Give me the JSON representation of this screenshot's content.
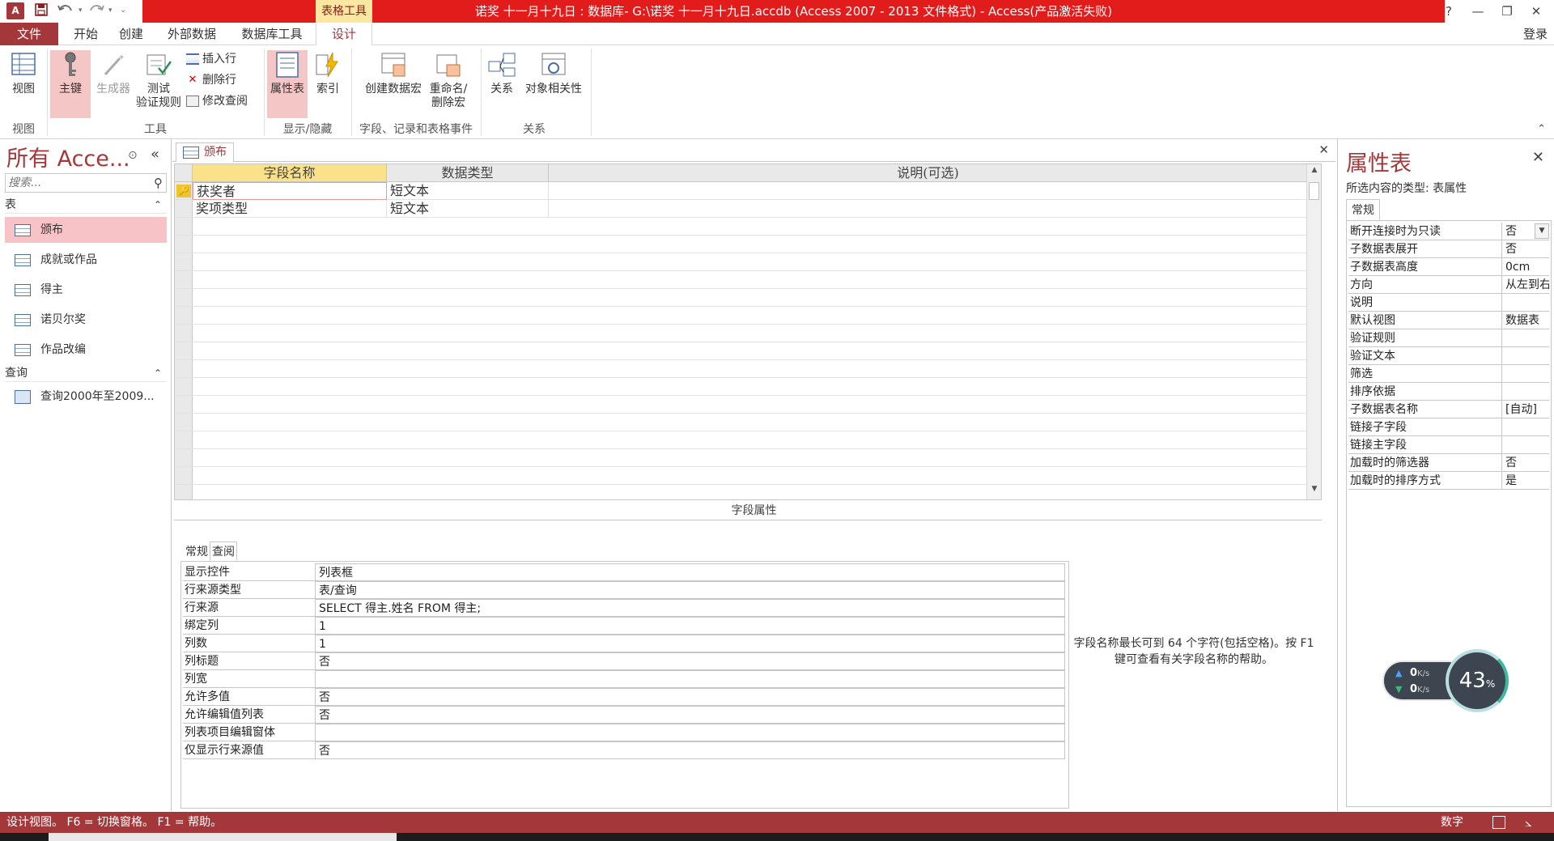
{
  "window": {
    "title": "诺奖 十一月十九日 : 数据库- G:\\诺奖 十一月十九日.accdb (Access 2007 - 2013 文件格式) - Access(产品激活失败)",
    "app_logo": "A",
    "context_tab": "表格工具",
    "controls": {
      "help": "?",
      "minimize": "—",
      "restore": "❐",
      "close": "✕"
    }
  },
  "tabs": [
    {
      "label": "文件"
    },
    {
      "label": "开始"
    },
    {
      "label": "创建"
    },
    {
      "label": "外部数据"
    },
    {
      "label": "数据库工具"
    },
    {
      "label": "设计"
    }
  ],
  "login": "登录",
  "ribbon": {
    "view": "视图",
    "primary_key": "主键",
    "builder": "生成器",
    "test_validation": "测试\n验证规则",
    "insert_row": "插入行",
    "delete_row": "删除行",
    "modify_lookups": "修改查阅",
    "property_sheet": "属性表",
    "indexes": "索引",
    "create_data_macros": "创建数据宏",
    "rename_delete_macro": "重命名/\n删除宏",
    "relationships": "关系",
    "object_dependencies": "对象相关性",
    "groups": [
      "视图",
      "工具",
      "显示/隐藏",
      "字段、记录和表格事件",
      "关系"
    ]
  },
  "nav": {
    "title": "所有 Acce...",
    "search_placeholder": "搜索...",
    "sections": [
      {
        "label": "表",
        "items": [
          "颁布",
          "成就或作品",
          "得主",
          "诺贝尔奖",
          "作品改编"
        ]
      },
      {
        "label": "查询",
        "items": [
          "查询2000年至2009..."
        ]
      }
    ],
    "selected": "颁布"
  },
  "document": {
    "tab_label": "颁布",
    "columns": [
      "字段名称",
      "数据类型",
      "说明(可选)"
    ],
    "fields": [
      {
        "name": "获奖者",
        "type": "短文本",
        "desc": ""
      },
      {
        "name": "奖项类型",
        "type": "短文本",
        "desc": ""
      }
    ]
  },
  "field_properties": {
    "title": "字段属性",
    "tabs": [
      "常规",
      "查阅"
    ],
    "active_tab": "查阅",
    "rows": [
      {
        "key": "显示控件",
        "value": "列表框"
      },
      {
        "key": "行来源类型",
        "value": "表/查询"
      },
      {
        "key": "行来源",
        "value": "SELECT 得主.姓名 FROM 得主;"
      },
      {
        "key": "绑定列",
        "value": "1"
      },
      {
        "key": "列数",
        "value": "1"
      },
      {
        "key": "列标题",
        "value": "否"
      },
      {
        "key": "列宽",
        "value": ""
      },
      {
        "key": "允许多值",
        "value": "否"
      },
      {
        "key": "允许编辑值列表",
        "value": "否"
      },
      {
        "key": "列表项目编辑窗体",
        "value": ""
      },
      {
        "key": "仅显示行来源值",
        "value": "否"
      }
    ],
    "help": "字段名称最长可到 64 个字符(包括空格)。按 F1 键可查看有关字段名称的帮助。"
  },
  "property_sheet": {
    "title": "属性表",
    "selection_type": "所选内容的类型: 表属性",
    "tab": "常规",
    "rows": [
      {
        "key": "断开连接时为只读",
        "value": "否"
      },
      {
        "key": "子数据表展开",
        "value": "否"
      },
      {
        "key": "子数据表高度",
        "value": "0cm"
      },
      {
        "key": "方向",
        "value": "从左到右"
      },
      {
        "key": "说明",
        "value": ""
      },
      {
        "key": "默认视图",
        "value": "数据表"
      },
      {
        "key": "验证规则",
        "value": ""
      },
      {
        "key": "验证文本",
        "value": ""
      },
      {
        "key": "筛选",
        "value": ""
      },
      {
        "key": "排序依据",
        "value": ""
      },
      {
        "key": "子数据表名称",
        "value": "[自动]"
      },
      {
        "key": "链接子字段",
        "value": ""
      },
      {
        "key": "链接主字段",
        "value": ""
      },
      {
        "key": "加载时的筛选器",
        "value": "否"
      },
      {
        "key": "加载时的排序方式",
        "value": "是"
      }
    ]
  },
  "net_widget": {
    "up": "0",
    "down": "0",
    "unit": "K/s",
    "percent": "43",
    "pct_sign": "%"
  },
  "status": {
    "text": "设计视图。 F6 = 切换窗格。 F1 = 帮助。",
    "numlock": "数字"
  },
  "icons": {
    "save": "save-icon",
    "undo": "undo-icon",
    "redo": "redo-icon",
    "search": "search-icon",
    "collapse": "chevron-up-icon"
  },
  "colors": {
    "accent": "#a4373a",
    "title_red": "#e21b1b",
    "context_tab": "#fbe7a1",
    "selected_nav": "#f7c3c6"
  }
}
